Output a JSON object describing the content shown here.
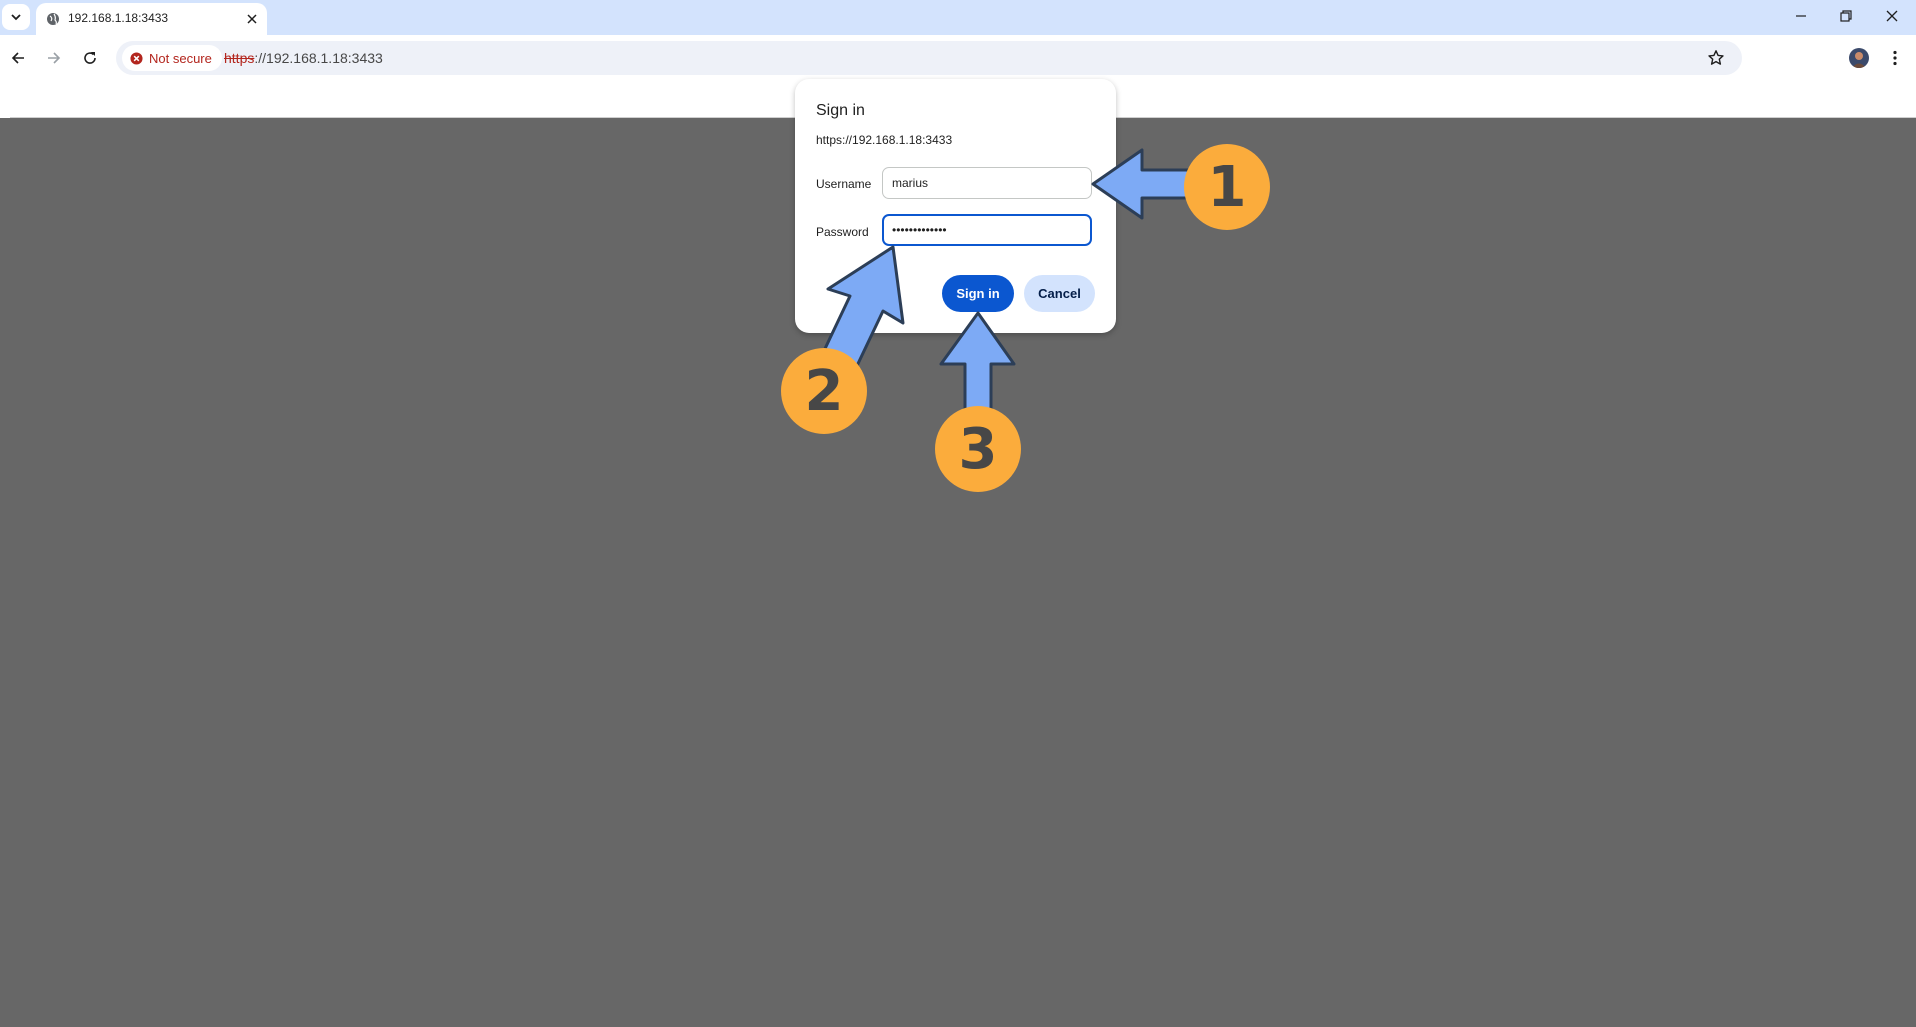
{
  "browser": {
    "tab_title": "192.168.1.18:3433",
    "security_label": "Not secure",
    "url_scheme": "https",
    "url_rest": "://192.168.1.18:3433"
  },
  "dialog": {
    "title": "Sign in",
    "origin": "https://192.168.1.18:3433",
    "username_label": "Username",
    "username_value": "marius",
    "password_label": "Password",
    "password_value": "•••••••••••••",
    "signin_label": "Sign in",
    "cancel_label": "Cancel"
  },
  "annotations": {
    "badges": [
      "1",
      "2",
      "3"
    ]
  },
  "colors": {
    "accent": "#0b57d0",
    "badge": "#fbac3c",
    "arrow_fill": "#7daaf5",
    "warning": "#b3261e"
  }
}
